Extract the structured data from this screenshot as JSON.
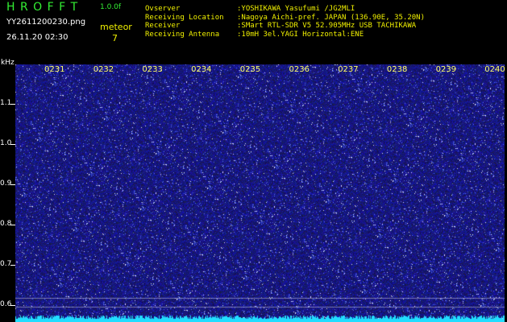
{
  "header": {
    "logo": "H R O F F T",
    "version": "1.0.0f",
    "filename": "YY2611200230.png",
    "datetime": "26.11.20 02:30",
    "meteor_label": "meteor",
    "meteor_count": "7"
  },
  "station": {
    "rows": [
      {
        "key": "Ovserver",
        "value": ":YOSHIKAWA Yasufumi /JG2MLI"
      },
      {
        "key": "Receiving Location",
        "value": ":Nagoya Aichi-pref. JAPAN (136.90E, 35.20N)"
      },
      {
        "key": "Receiver",
        "value": ":SMart RTL-SDR V5 52.905MHz USB TACHIKAWA"
      },
      {
        "key": "Receiving Antenna",
        "value": ":10mH 3el.YAGI Horizontal:ENE"
      }
    ]
  },
  "axis": {
    "unit": "kHz",
    "freq_labels": [
      {
        "label": "1.1",
        "value": 1.1
      },
      {
        "label": "1.0",
        "value": 1.0
      },
      {
        "label": "0.9",
        "value": 0.9
      },
      {
        "label": "0.8",
        "value": 0.8
      },
      {
        "label": "0.7",
        "value": 0.7
      },
      {
        "label": "0.6",
        "value": 0.6
      }
    ],
    "time_labels": [
      "0231",
      "0232",
      "0233",
      "0234",
      "0235",
      "0236",
      "0237",
      "0238",
      "0239",
      "0240"
    ]
  },
  "colors": {
    "background": "#000000",
    "spectrogram_base": "#1a1a9a",
    "noise_speck": "#ffffff",
    "baseline": "#22ddff",
    "logo": "#33ee33",
    "station_text": "#f0f000"
  }
}
